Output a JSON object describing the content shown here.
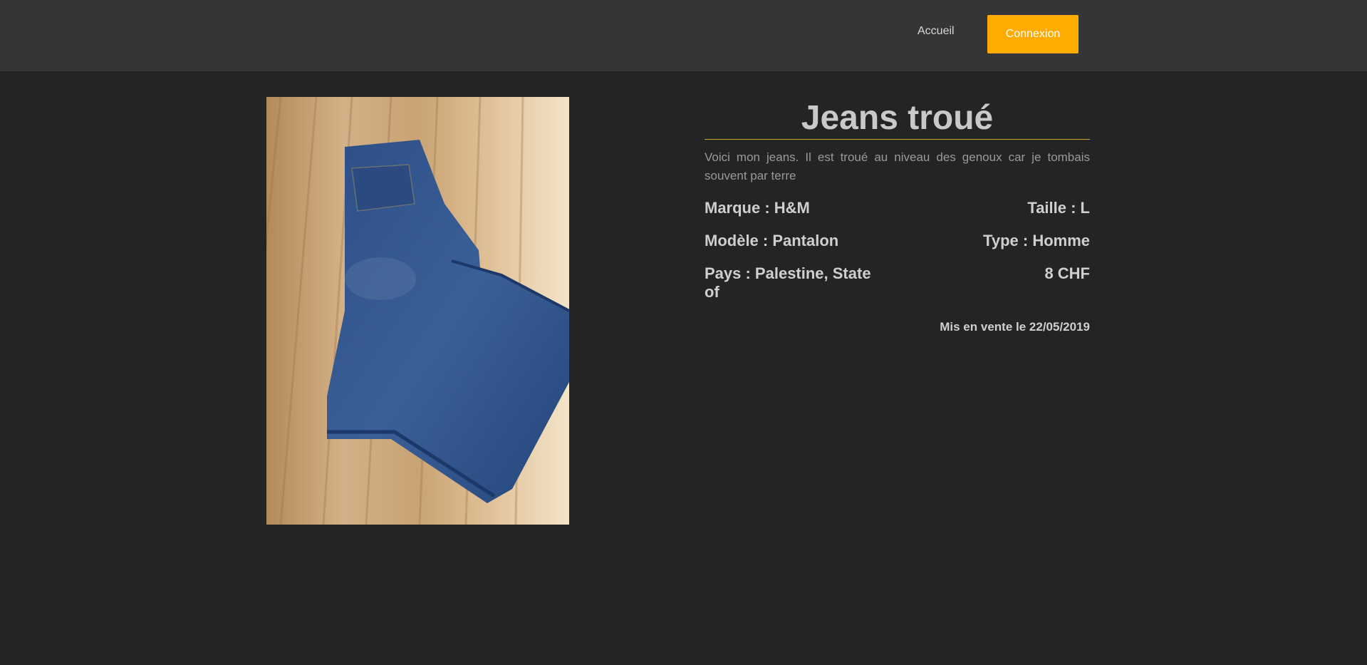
{
  "nav": {
    "home_label": "Accueil",
    "login_label": "Connexion"
  },
  "product": {
    "title": "Jeans troué",
    "description": "Voici mon jeans. Il est troué au niveau des genoux car je tombais souvent par terre",
    "brand": "Marque : H&M",
    "size": "Taille : L",
    "model": "Modèle : Pantalon",
    "type": "Type : Homme",
    "country": "Pays : Palestine, State of",
    "price": "8 CHF",
    "posted": "Mis en vente le 22/05/2019"
  },
  "colors": {
    "accent": "#ffab00",
    "header_bg": "#343537",
    "page_bg": "#232425"
  }
}
